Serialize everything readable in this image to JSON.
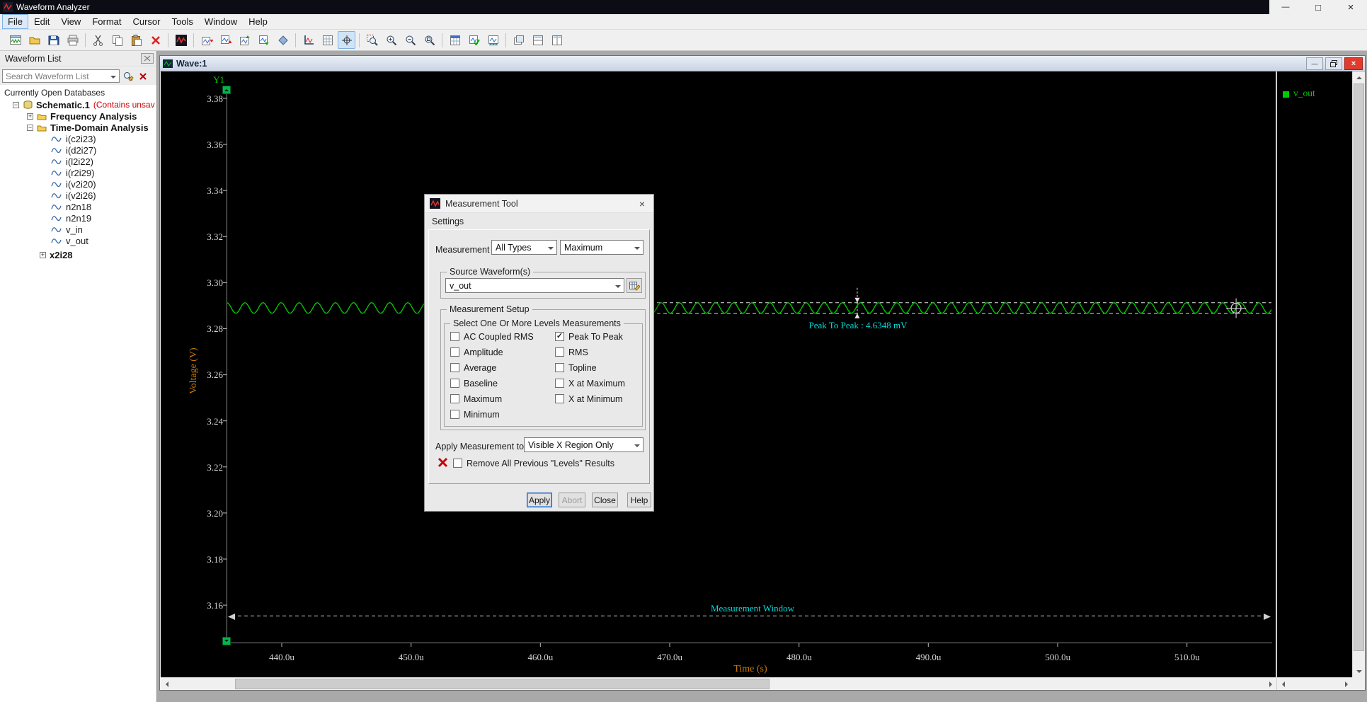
{
  "app": {
    "title": "Waveform Analyzer"
  },
  "icons": {
    "minimize": "—",
    "maximize": "□",
    "close": "×",
    "check": "✓"
  },
  "menu": {
    "items": [
      {
        "label": "File"
      },
      {
        "label": "Edit"
      },
      {
        "label": "View"
      },
      {
        "label": "Format"
      },
      {
        "label": "Cursor"
      },
      {
        "label": "Tools"
      },
      {
        "label": "Window"
      },
      {
        "label": "Help"
      }
    ],
    "active": "File"
  },
  "toolbar": {
    "icons": [
      "new-waveform-window",
      "open-database",
      "save",
      "print",
      "cut",
      "copy",
      "paste",
      "delete",
      "analyzer-home",
      "add-wave-above",
      "add-wave-below",
      "move-wave-up",
      "move-wave-down",
      "snap-to-data",
      "new-axis",
      "data-grid",
      "track-cursor",
      "zoom-area",
      "zoom-in",
      "zoom-out",
      "zoom-full",
      "spreadsheet",
      "measurement-results",
      "measurement-tool",
      "cascade-windows",
      "tile-horizontal",
      "tile-vertical"
    ]
  },
  "sidebar": {
    "title": "Waveform List",
    "search_text": "Search Waveform List",
    "databases_label": "Currently Open Databases",
    "tree": {
      "root_label": "Schematic.1",
      "root_note": "(Contains unsav",
      "group_frequency": "Frequency Analysis",
      "group_time_domain": "Time-Domain Analysis",
      "signals": [
        "i(c2i23)",
        "i(d2i27)",
        "i(l2i22)",
        "i(r2i29)",
        "i(v2i20)",
        "i(v2i26)",
        "n2n18",
        "n2n19",
        "v_in",
        "v_out"
      ],
      "subckt_label": "x2i28"
    }
  },
  "wave_window": {
    "title": "Wave:1",
    "legend_label": "v_out"
  },
  "chart_data": {
    "type": "line",
    "title": "Wave:1",
    "xlabel": "Time (s)",
    "ylabel": "Voltage (V)",
    "axis_label": "Y1",
    "grid": false,
    "legend_position": "right",
    "x_ticks": [
      "440.0u",
      "450.0u",
      "460.0u",
      "470.0u",
      "480.0u",
      "490.0u",
      "500.0u",
      "510.0u"
    ],
    "x_tick_values_us": [
      440,
      450,
      460,
      470,
      480,
      490,
      500,
      510
    ],
    "x_range_us": [
      435.7,
      516.6
    ],
    "y_ticks": [
      "3.38",
      "3.36",
      "3.34",
      "3.32",
      "3.30",
      "3.28",
      "3.26",
      "3.24",
      "3.22",
      "3.20",
      "3.18",
      "3.16"
    ],
    "y_tick_values": [
      3.38,
      3.36,
      3.34,
      3.32,
      3.3,
      3.28,
      3.26,
      3.24,
      3.22,
      3.2,
      3.18,
      3.16
    ],
    "y_range_v": [
      3.144,
      3.384
    ],
    "series": [
      {
        "name": "v_out",
        "color": "#00d000",
        "shape": "sine-ripple",
        "baseline_v": 3.289,
        "peak_to_peak_v": 0.0046348,
        "ripple_period_us": 1.4
      }
    ],
    "annotations": {
      "peak_to_peak": {
        "label": "Peak To Peak : 4.6348 mV",
        "value_mV": 4.6348,
        "top_v": 3.291317,
        "bottom_v": 3.286683,
        "marker_x_us": 484.5,
        "color": "#00dddd"
      },
      "measurement_window": {
        "label": "Measurement Window",
        "x_start_us": 436.0,
        "x_end_us": 516.3,
        "y_v": 3.1553,
        "color": "#00dddd"
      }
    },
    "cursor": {
      "x_us": 513.8,
      "y_v": 3.2889
    }
  },
  "dialog": {
    "title": "Measurement Tool",
    "section_label": "Settings",
    "measurement_label": "Measurement :",
    "type_combo_value": "All Types",
    "function_combo_value": "Maximum",
    "source_group_label": "Source Waveform(s)",
    "source_combo_value": "v_out",
    "setup_group_label": "Measurement Setup",
    "levels_group_label": "Select One Or More Levels Measurements",
    "checkboxes_left": [
      {
        "label": "AC Coupled RMS",
        "check": ""
      },
      {
        "label": "Amplitude",
        "check": ""
      },
      {
        "label": "Average",
        "check": ""
      },
      {
        "label": "Baseline",
        "check": ""
      },
      {
        "label": "Maximum",
        "check": ""
      },
      {
        "label": "Minimum",
        "check": ""
      }
    ],
    "checkboxes_right": [
      {
        "label": "Peak To Peak",
        "check": "✓"
      },
      {
        "label": "RMS",
        "check": ""
      },
      {
        "label": "Topline",
        "check": ""
      },
      {
        "label": "X at Maximum",
        "check": ""
      },
      {
        "label": "X at Minimum",
        "check": ""
      }
    ],
    "apply_to_label": "Apply Measurement to :",
    "apply_to_combo_value": "Visible X Region Only",
    "remove_label": "Remove All Previous \"Levels\" Results",
    "buttons": {
      "apply": "Apply",
      "abort": "Abort",
      "close": "Close",
      "help": "Help"
    }
  }
}
